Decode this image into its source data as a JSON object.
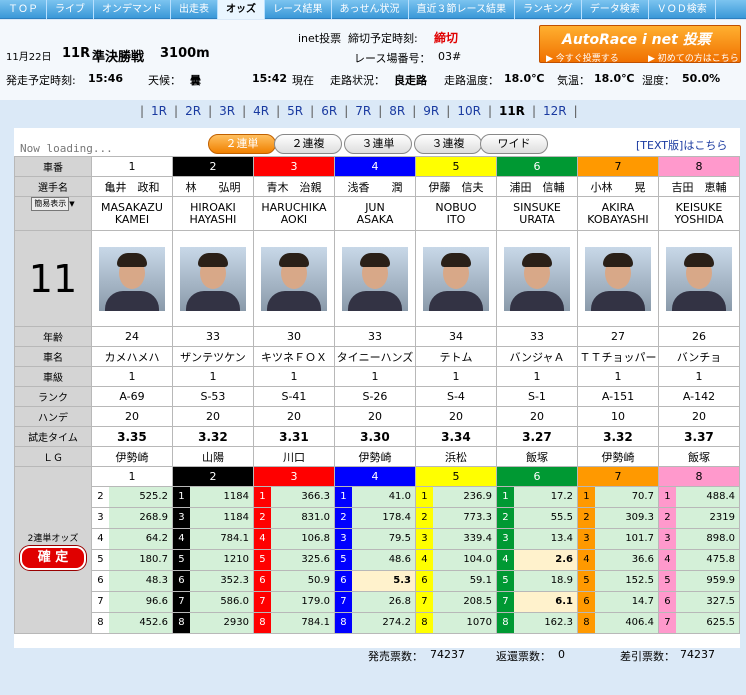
{
  "nav": [
    "ＴＯＰ",
    "ライブ",
    "オンデマンド",
    "出走表",
    "オッズ",
    "レース結果",
    "あっせん状況",
    "直近３節レース結果",
    "ランキング",
    "データ検索",
    "ＶＯＤ検索"
  ],
  "nav_active": 4,
  "info": {
    "date": "11月22日",
    "race": "11R",
    "race_name": "準決勝戦",
    "distance": "3100m",
    "inet_label": "inet投票",
    "deadline_label": "締切予定時刻:",
    "deadline_value": "締切",
    "venue_label": "レース場番号：",
    "venue_value": "03#",
    "start_label": "発走予定時刻:",
    "start_value": "15:46",
    "weather_label": "天候：",
    "weather_value": "曇",
    "now_time": "15:42",
    "now_label": "現在",
    "track_label": "走路状況：",
    "track_value": "良走路",
    "track_temp_label": "走路温度：",
    "track_temp_value": "18.0℃",
    "air_temp_label": "気温：",
    "air_temp_value": "18.0℃",
    "humidity_label": "湿度：",
    "humidity_value": "50.0%"
  },
  "banner": {
    "title": "AutoRace i net 投票",
    "link1": "▶ 今すぐ投票する",
    "link2": "▶ 初めての方はこちら"
  },
  "race_tabs": [
    "1R",
    "2R",
    "3R",
    "4R",
    "5R",
    "6R",
    "7R",
    "8R",
    "9R",
    "10R",
    "11R",
    "12R"
  ],
  "race_tab_current": 10,
  "loading": "Now loading...",
  "bet_types": [
    "２連単",
    "２連複",
    "３連単",
    "３連複",
    "ワイド"
  ],
  "bet_active": 0,
  "text_link": "[TEXT版]はこちら",
  "labels": {
    "car_no": "車番",
    "rider": "選手名",
    "simple": "簡易表示",
    "age": "年齢",
    "car_name": "車名",
    "car_class": "車級",
    "rank": "ランク",
    "handicap": "ハンデ",
    "trial": "試走タイム",
    "lg": "ＬＧ",
    "odds_title": "2連単オッズ",
    "confirmed": "確 定"
  },
  "race_big": "11",
  "colors": {
    "1": "#ffffff",
    "2": "#000000",
    "3": "#ff0000",
    "4": "#0000ff",
    "5": "#ffff00",
    "6": "#009933",
    "7": "#ff9900",
    "8": "#ff99cc"
  },
  "riders": [
    {
      "no": "1",
      "name": "亀井　政和",
      "en1": "MASAKAZU",
      "en2": "KAMEI",
      "age": "24",
      "car": "カメハメハ",
      "cls": "1",
      "rank": "A-69",
      "hc": "20",
      "trial": "3.35",
      "lg": "伊勢崎"
    },
    {
      "no": "2",
      "name": "林　　弘明",
      "en1": "HIROAKI",
      "en2": "HAYASHI",
      "age": "33",
      "car": "ザンテツケン",
      "cls": "1",
      "rank": "S-53",
      "hc": "20",
      "trial": "3.32",
      "lg": "山陽"
    },
    {
      "no": "3",
      "name": "青木　治親",
      "en1": "HARUCHIKA",
      "en2": "AOKI",
      "age": "30",
      "car": "キツネＦＯＸ",
      "cls": "1",
      "rank": "S-41",
      "hc": "20",
      "trial": "3.31",
      "lg": "川口"
    },
    {
      "no": "4",
      "name": "浅香　　潤",
      "en1": "JUN",
      "en2": "ASAKA",
      "age": "33",
      "car": "タイニーハンズ",
      "cls": "1",
      "rank": "S-26",
      "hc": "20",
      "trial": "3.30",
      "lg": "伊勢崎"
    },
    {
      "no": "5",
      "name": "伊藤　信夫",
      "en1": "NOBUO",
      "en2": "ITO",
      "age": "34",
      "car": "テトム",
      "cls": "1",
      "rank": "S-4",
      "hc": "20",
      "trial": "3.34",
      "lg": "浜松"
    },
    {
      "no": "6",
      "name": "浦田　信輔",
      "en1": "SINSUKE",
      "en2": "URATA",
      "age": "33",
      "car": "バンジャＡ",
      "cls": "1",
      "rank": "S-1",
      "hc": "20",
      "trial": "3.27",
      "lg": "飯塚"
    },
    {
      "no": "7",
      "name": "小林　　晃",
      "en1": "AKIRA",
      "en2": "KOBAYASHI",
      "age": "27",
      "car": "ＴＴチョッパー",
      "cls": "1",
      "rank": "A-151",
      "hc": "10",
      "trial": "3.32",
      "lg": "伊勢崎"
    },
    {
      "no": "8",
      "name": "吉田　恵輔",
      "en1": "KEISUKE",
      "en2": "YOSHIDA",
      "age": "26",
      "car": "バンチョ",
      "cls": "1",
      "rank": "A-142",
      "hc": "20",
      "trial": "3.37",
      "lg": "飯塚"
    }
  ],
  "odds": [
    [
      [
        "2",
        "525.2"
      ],
      [
        "1",
        "1184"
      ],
      [
        "1",
        "366.3"
      ],
      [
        "1",
        "41.0"
      ],
      [
        "1",
        "236.9"
      ],
      [
        "1",
        "17.2"
      ],
      [
        "1",
        "70.7"
      ],
      [
        "1",
        "488.4"
      ]
    ],
    [
      [
        "3",
        "268.9"
      ],
      [
        "3",
        "1184"
      ],
      [
        "2",
        "831.0"
      ],
      [
        "2",
        "178.4"
      ],
      [
        "2",
        "773.3"
      ],
      [
        "2",
        "55.5"
      ],
      [
        "2",
        "309.3"
      ],
      [
        "2",
        "2319"
      ]
    ],
    [
      [
        "4",
        "64.2"
      ],
      [
        "4",
        "784.1"
      ],
      [
        "4",
        "106.8"
      ],
      [
        "3",
        "79.5"
      ],
      [
        "3",
        "339.4"
      ],
      [
        "3",
        "13.4"
      ],
      [
        "3",
        "101.7"
      ],
      [
        "3",
        "898.0"
      ]
    ],
    [
      [
        "5",
        "180.7"
      ],
      [
        "5",
        "1210"
      ],
      [
        "5",
        "325.6"
      ],
      [
        "5",
        "48.6"
      ],
      [
        "4",
        "104.0"
      ],
      [
        "4",
        "2.6"
      ],
      [
        "4",
        "36.6"
      ],
      [
        "4",
        "475.8"
      ]
    ],
    [
      [
        "6",
        "48.3"
      ],
      [
        "6",
        "352.3"
      ],
      [
        "6",
        "50.9"
      ],
      [
        "6",
        "5.3"
      ],
      [
        "6",
        "59.1"
      ],
      [
        "5",
        "18.9"
      ],
      [
        "5",
        "152.5"
      ],
      [
        "5",
        "959.9"
      ]
    ],
    [
      [
        "7",
        "96.6"
      ],
      [
        "7",
        "586.0"
      ],
      [
        "7",
        "179.0"
      ],
      [
        "7",
        "26.8"
      ],
      [
        "7",
        "208.5"
      ],
      [
        "7",
        "6.1"
      ],
      [
        "6",
        "14.7"
      ],
      [
        "6",
        "327.5"
      ]
    ],
    [
      [
        "8",
        "452.6"
      ],
      [
        "8",
        "2930"
      ],
      [
        "8",
        "784.1"
      ],
      [
        "8",
        "274.2"
      ],
      [
        "8",
        "1070"
      ],
      [
        "8",
        "162.3"
      ],
      [
        "8",
        "406.4"
      ],
      [
        "7",
        "625.5"
      ]
    ]
  ],
  "odds_highlight": [
    [
      4,
      3
    ],
    [
      3,
      5
    ],
    [
      5,
      5
    ]
  ],
  "footer": {
    "sales_label": "発売票数：",
    "sales_value": "74237",
    "refund_label": "返還票数：",
    "refund_value": "0",
    "net_label": "差引票数：",
    "net_value": "74237"
  }
}
